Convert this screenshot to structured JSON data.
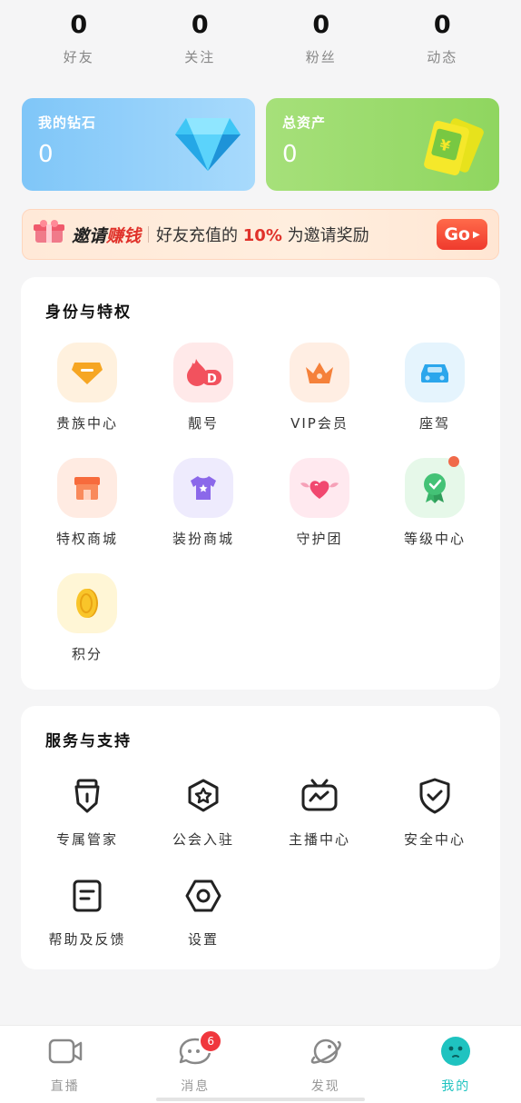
{
  "stats": [
    {
      "value": "0",
      "label": "好友"
    },
    {
      "value": "0",
      "label": "关注"
    },
    {
      "value": "0",
      "label": "粉丝"
    },
    {
      "value": "0",
      "label": "动态"
    }
  ],
  "cards": {
    "diamond": {
      "title": "我的钻石",
      "value": "0",
      "icon": "diamond-icon"
    },
    "assets": {
      "title": "总资产",
      "value": "0",
      "icon": "money-ticket-icon"
    }
  },
  "invite": {
    "title_a": "邀请",
    "title_b": "赚钱",
    "text_a": "好友充值的 ",
    "pct": "10%",
    "text_b": " 为邀请奖励",
    "button": "Go"
  },
  "identity": {
    "title": "身份与特权",
    "items": [
      {
        "label": "贵族中心",
        "icon": "noble-badge-icon",
        "bg": "#fff1de"
      },
      {
        "label": "靓号",
        "icon": "fire-id-icon",
        "bg": "#ffe9e9"
      },
      {
        "label": "VIP会员",
        "icon": "crown-icon",
        "bg": "#ffeee3"
      },
      {
        "label": "座驾",
        "icon": "car-icon",
        "bg": "#e5f4fd"
      },
      {
        "label": "特权商城",
        "icon": "store-icon",
        "bg": "#ffebe2"
      },
      {
        "label": "装扮商城",
        "icon": "tshirt-icon",
        "bg": "#eeebfd"
      },
      {
        "label": "守护团",
        "icon": "winged-heart-icon",
        "bg": "#ffe9ef"
      },
      {
        "label": "等级中心",
        "icon": "medal-icon",
        "bg": "#e6f8e9"
      },
      {
        "label": "积分",
        "icon": "coin-icon",
        "bg": "#fff6d6"
      }
    ]
  },
  "service": {
    "title": "服务与支持",
    "items": [
      {
        "label": "专属管家",
        "icon": "steward-icon"
      },
      {
        "label": "公会入驻",
        "icon": "guild-icon"
      },
      {
        "label": "主播中心",
        "icon": "tv-icon"
      },
      {
        "label": "安全中心",
        "icon": "shield-check-icon"
      },
      {
        "label": "帮助及反馈",
        "icon": "feedback-icon"
      },
      {
        "label": "设置",
        "icon": "settings-icon"
      }
    ]
  },
  "tabs": [
    {
      "label": "直播",
      "icon": "camera-icon"
    },
    {
      "label": "消息",
      "icon": "chat-icon",
      "badge": "6"
    },
    {
      "label": "发现",
      "icon": "planet-icon"
    },
    {
      "label": "我的",
      "icon": "profile-face-icon",
      "active": true
    }
  ],
  "colors": {
    "accent": "#1fc3c0",
    "red": "#e0322a",
    "badge": "#f0373d"
  }
}
